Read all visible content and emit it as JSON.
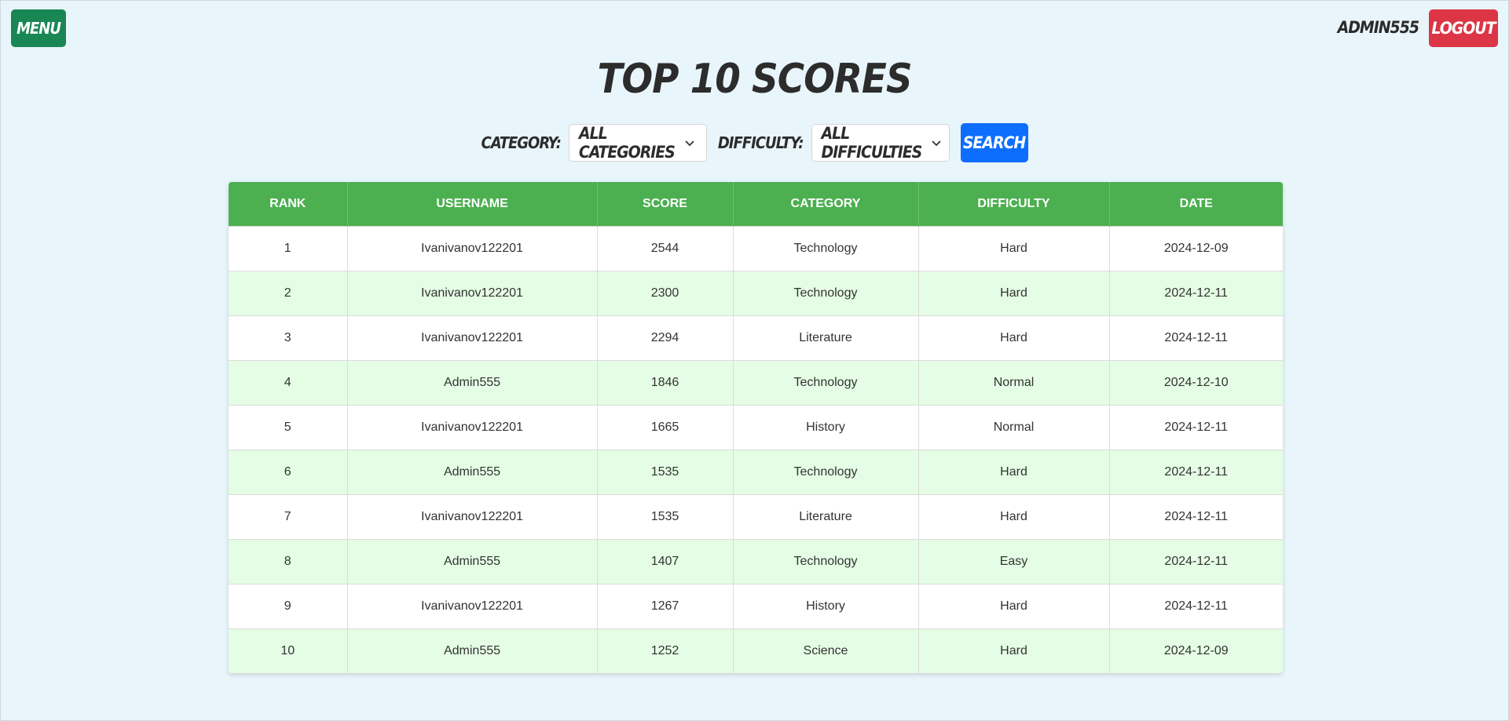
{
  "header": {
    "menu_label": "Menu",
    "username": "Admin555",
    "logout_label": "Logout"
  },
  "page": {
    "title": "Top 10 Scores"
  },
  "filters": {
    "category_label": "Category:",
    "category_value": "All Categories",
    "difficulty_label": "Difficulty:",
    "difficulty_value": "All Difficulties",
    "search_label": "Search"
  },
  "table": {
    "columns": [
      "RANK",
      "USERNAME",
      "SCORE",
      "CATEGORY",
      "DIFFICULTY",
      "DATE"
    ],
    "rows": [
      [
        "1",
        "Ivanivanov122201",
        "2544",
        "Technology",
        "Hard",
        "2024-12-09"
      ],
      [
        "2",
        "Ivanivanov122201",
        "2300",
        "Technology",
        "Hard",
        "2024-12-11"
      ],
      [
        "3",
        "Ivanivanov122201",
        "2294",
        "Literature",
        "Hard",
        "2024-12-11"
      ],
      [
        "4",
        "Admin555",
        "1846",
        "Technology",
        "Normal",
        "2024-12-10"
      ],
      [
        "5",
        "Ivanivanov122201",
        "1665",
        "History",
        "Normal",
        "2024-12-11"
      ],
      [
        "6",
        "Admin555",
        "1535",
        "Technology",
        "Hard",
        "2024-12-11"
      ],
      [
        "7",
        "Ivanivanov122201",
        "1535",
        "Literature",
        "Hard",
        "2024-12-11"
      ],
      [
        "8",
        "Admin555",
        "1407",
        "Technology",
        "Easy",
        "2024-12-11"
      ],
      [
        "9",
        "Ivanivanov122201",
        "1267",
        "History",
        "Hard",
        "2024-12-11"
      ],
      [
        "10",
        "Admin555",
        "1252",
        "Science",
        "Hard",
        "2024-12-09"
      ]
    ]
  },
  "colors": {
    "background": "#e8f5fb",
    "menu_button": "#198754",
    "logout_button": "#dc3545",
    "search_button": "#0d6efd",
    "table_header": "#4caf50",
    "row_alt": "#e4fde4"
  }
}
